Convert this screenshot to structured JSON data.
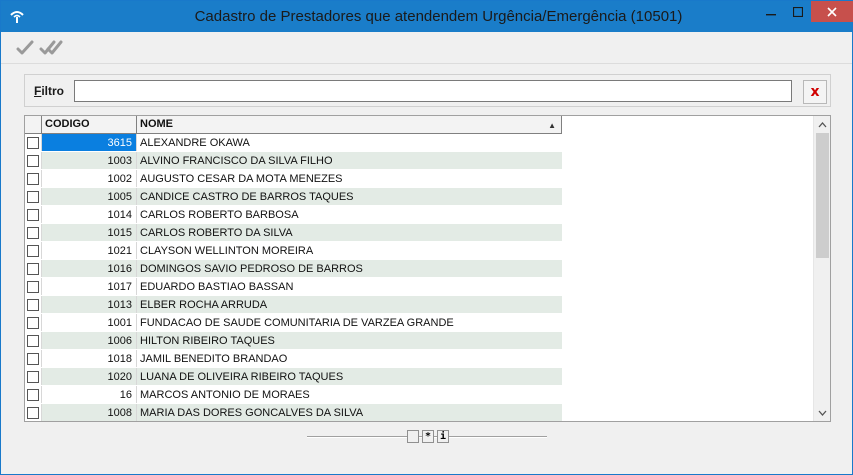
{
  "window": {
    "title": "Cadastro de Prestadores que atendendem Urgência/Emergência (10501)",
    "app_icon": "app-logo-icon",
    "controls": {
      "minimize": "─",
      "maximize": "☐",
      "close": "✕"
    }
  },
  "toolbar": {
    "confirm_icon": "check-icon",
    "confirm_all_icon": "double-check-icon"
  },
  "filter": {
    "label_prefix": "F",
    "label_rest": "iltro",
    "value": "",
    "clear_label": "x"
  },
  "grid": {
    "columns": {
      "codigo": "CODIGO",
      "nome": "NOME"
    },
    "sort_indicator": "▲",
    "rows": [
      {
        "codigo": "3615",
        "nome": "ALEXANDRE OKAWA"
      },
      {
        "codigo": "1003",
        "nome": "ALVINO FRANCISCO DA SILVA FILHO"
      },
      {
        "codigo": "1002",
        "nome": "AUGUSTO CESAR DA MOTA MENEZES"
      },
      {
        "codigo": "1005",
        "nome": "CANDICE CASTRO DE BARROS TAQUES"
      },
      {
        "codigo": "1014",
        "nome": "CARLOS ROBERTO  BARBOSA"
      },
      {
        "codigo": "1015",
        "nome": "CARLOS ROBERTO DA SILVA"
      },
      {
        "codigo": "1021",
        "nome": "CLAYSON WELLINTON MOREIRA"
      },
      {
        "codigo": "1016",
        "nome": "DOMINGOS SAVIO PEDROSO DE BARROS"
      },
      {
        "codigo": "1017",
        "nome": "EDUARDO BASTIAO BASSAN"
      },
      {
        "codigo": "1013",
        "nome": "ELBER ROCHA ARRUDA"
      },
      {
        "codigo": "1001",
        "nome": "FUNDACAO DE SAUDE COMUNITARIA DE VARZEA GRANDE"
      },
      {
        "codigo": "1006",
        "nome": "HILTON RIBEIRO TAQUES"
      },
      {
        "codigo": "1018",
        "nome": "JAMIL BENEDITO BRANDAO"
      },
      {
        "codigo": "1020",
        "nome": "LUANA DE OLIVEIRA RIBEIRO TAQUES"
      },
      {
        "codigo": "16",
        "nome": "MARCOS ANTONIO DE MORAES"
      },
      {
        "codigo": "1008",
        "nome": "MARIA DAS DORES GONCALVES DA SILVA"
      }
    ],
    "selected_index": 0
  },
  "navigator": {
    "buttons": [
      "*",
      "i"
    ]
  },
  "colors": {
    "titlebar": "#1a7dc9",
    "selection": "#0a7fe0",
    "alt_row": "#e3ebe5",
    "close_red": "#d00000"
  }
}
